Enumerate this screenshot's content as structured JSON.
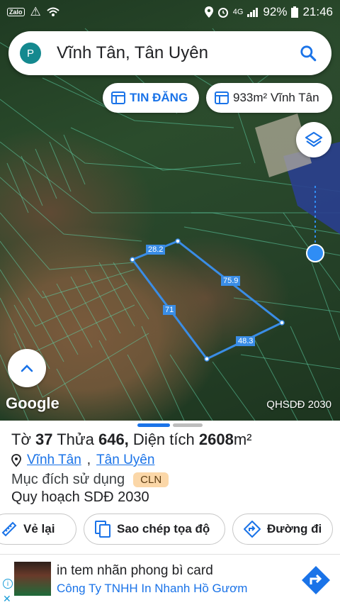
{
  "status_bar": {
    "zalo": "Zalo",
    "network": "4G",
    "battery": "92%",
    "time": "21:46"
  },
  "search": {
    "avatar_letter": "P",
    "query": "Vĩnh Tân, Tân Uyên"
  },
  "chips": {
    "listing": "TIN ĐĂNG",
    "area": "933m² Vĩnh Tân"
  },
  "map": {
    "edge_labels": [
      "28.2",
      "75.9",
      "71",
      "48.3"
    ],
    "brand": "Google",
    "layer_label": "QHSDĐ 2030"
  },
  "sheet": {
    "sheet_prefix": "Tờ",
    "sheet_no": "37",
    "plot_prefix": "Thửa",
    "plot_no": "646,",
    "area_prefix": "Diện tích",
    "area_value": "2608",
    "area_unit": "m²",
    "commune": "Vĩnh Tân",
    "district": "Tân Uyên",
    "purpose_label": "Mục đích sử dụng",
    "purpose_code": "CLN",
    "plan_label": "Quy hoạch SDĐ 2030"
  },
  "actions": {
    "draw": "Vẻ lại",
    "copy": "Sao chép tọa độ",
    "directions": "Đường đi"
  },
  "ad": {
    "title": "in tem nhãn phong bì card",
    "subtitle": "Công Ty TNHH In Nhanh Hồ Gươm"
  },
  "colors": {
    "accent": "#1a73e8",
    "parcel_outline": "#3a8de6",
    "badge": "#fbd7a8"
  }
}
